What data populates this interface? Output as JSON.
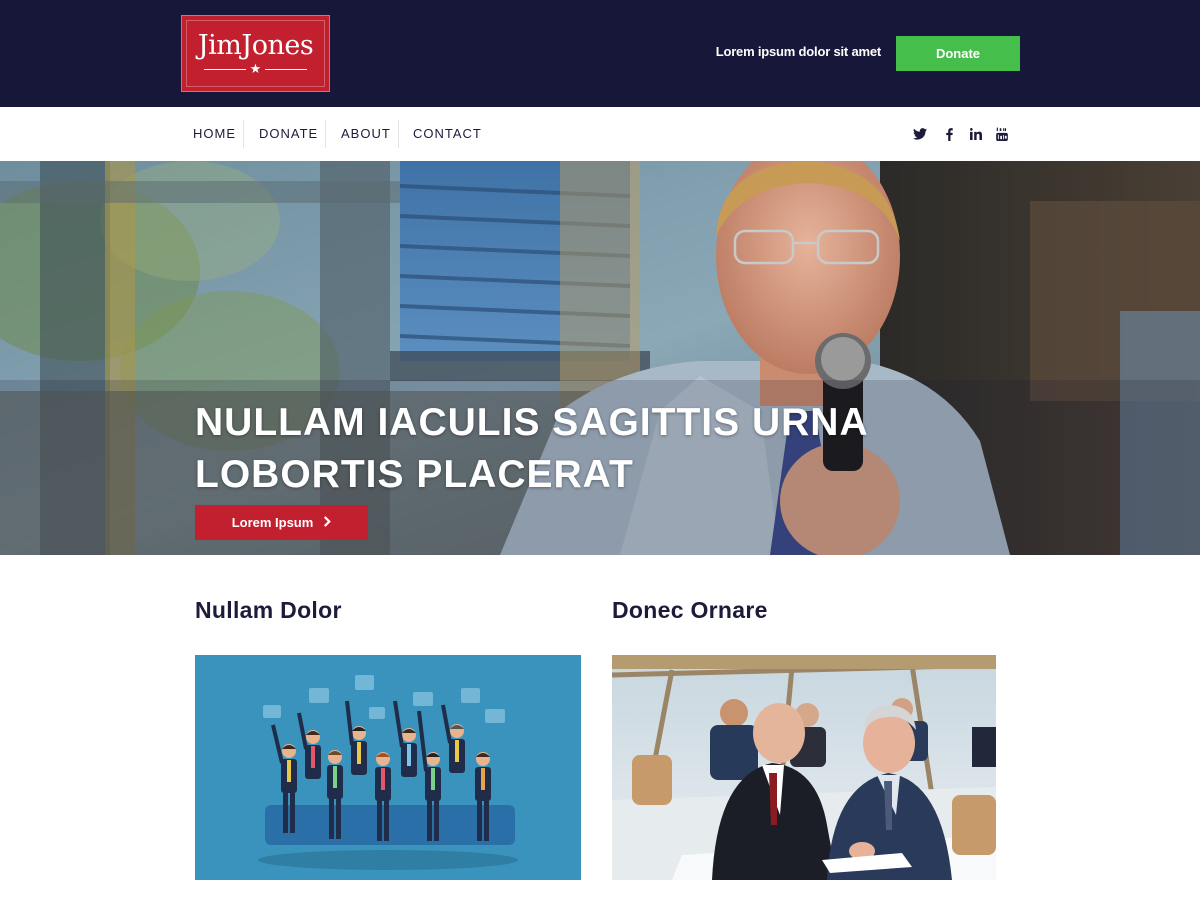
{
  "header": {
    "logo_text": "JimJones",
    "tagline": "Lorem ipsum dolor sit amet",
    "donate_label": "Donate"
  },
  "nav": {
    "items": [
      {
        "label": "HOME"
      },
      {
        "label": "DONATE"
      },
      {
        "label": "ABOUT"
      },
      {
        "label": "CONTACT"
      }
    ],
    "social": [
      "twitter-icon",
      "facebook-icon",
      "linkedin-icon",
      "youtube-icon"
    ]
  },
  "hero": {
    "title_line1": "NULLAM IACULIS SAGITTIS URNA",
    "title_line2": "LOBORTIS PLACERAT",
    "button_label": "Lorem Ipsum"
  },
  "cards": [
    {
      "title": "Nullam Dolor"
    },
    {
      "title": "Donec Ornare"
    }
  ],
  "colors": {
    "header_bg": "#17173a",
    "brand_red": "#c21f2f",
    "donate_green": "#46be4c",
    "text_dark": "#1c1c3a"
  }
}
